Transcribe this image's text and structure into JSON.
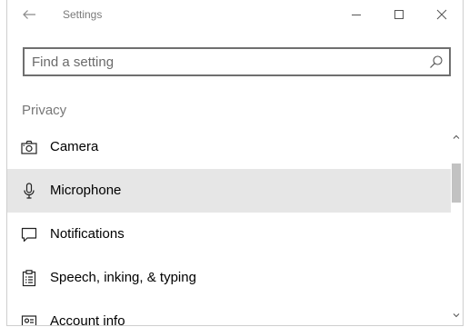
{
  "window": {
    "title": "Settings"
  },
  "search": {
    "placeholder": "Find a setting",
    "value": ""
  },
  "section": {
    "title": "Privacy"
  },
  "items": [
    {
      "label": "Camera",
      "icon": "camera-icon",
      "selected": false
    },
    {
      "label": "Microphone",
      "icon": "microphone-icon",
      "selected": true
    },
    {
      "label": "Notifications",
      "icon": "notifications-icon",
      "selected": false
    },
    {
      "label": "Speech, inking, & typing",
      "icon": "clipboard-icon",
      "selected": false
    },
    {
      "label": "Account info",
      "icon": "account-info-icon",
      "selected": false
    }
  ],
  "colors": {
    "selected_bg": "#e6e6e6",
    "muted_text": "#777777",
    "scroll_thumb": "#c2c2c2"
  }
}
